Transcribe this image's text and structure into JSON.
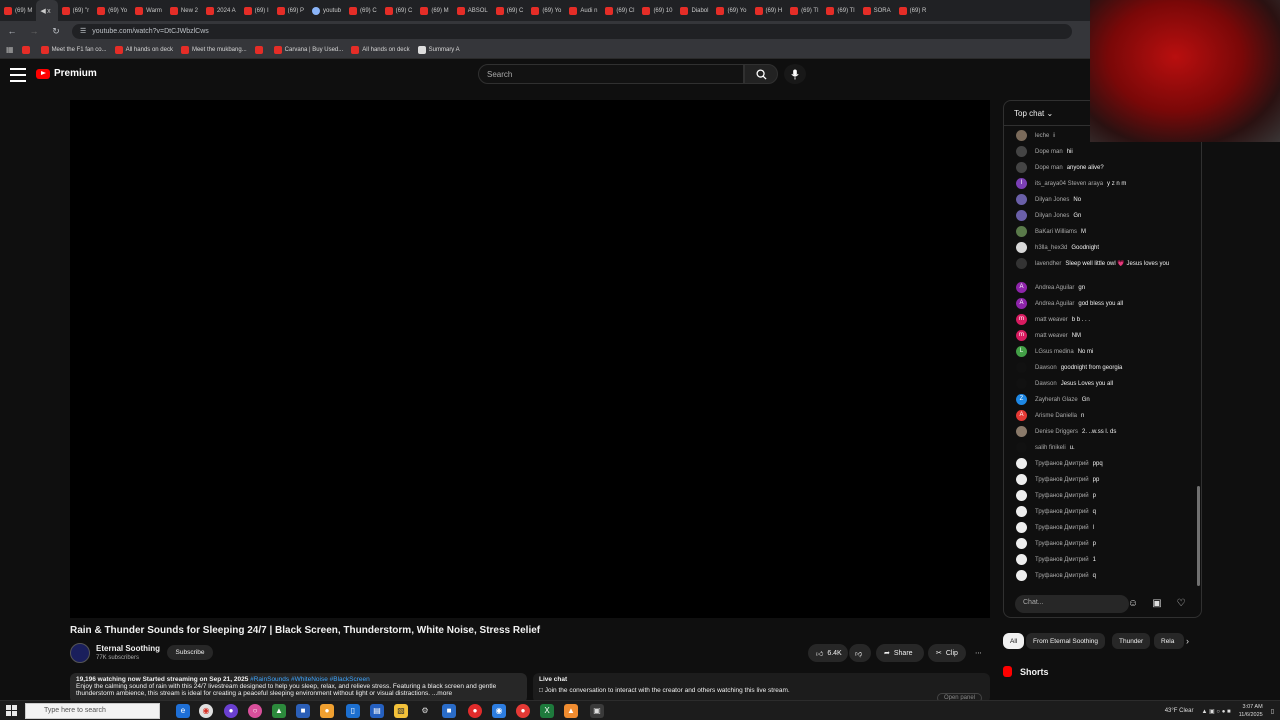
{
  "browser": {
    "tabs": [
      {
        "label": "(69) M",
        "icon": "youtube",
        "active": false
      },
      {
        "label": "",
        "icon": "volume",
        "active": true
      },
      {
        "label": "(69) \"r",
        "icon": "youtube",
        "active": false
      },
      {
        "label": "(69) Yo",
        "icon": "youtube",
        "active": false
      },
      {
        "label": "Warm",
        "icon": "youtube",
        "active": false
      },
      {
        "label": "New 2",
        "icon": "youtube",
        "active": false
      },
      {
        "label": "2024 A",
        "icon": "youtube",
        "active": false
      },
      {
        "label": "(69) I",
        "icon": "youtube",
        "active": false
      },
      {
        "label": "(69) P",
        "icon": "youtube",
        "active": false
      },
      {
        "label": "youtub",
        "icon": "globe",
        "active": false
      },
      {
        "label": "(69) C",
        "icon": "youtube",
        "active": false
      },
      {
        "label": "(69) C",
        "icon": "youtube",
        "active": false
      },
      {
        "label": "(69) M",
        "icon": "youtube",
        "active": false
      },
      {
        "label": "ABSOL",
        "icon": "youtube",
        "active": false
      },
      {
        "label": "(69) C",
        "icon": "youtube",
        "active": false
      },
      {
        "label": "(69) Yo",
        "icon": "youtube",
        "active": false
      },
      {
        "label": "Audi n",
        "icon": "youtube",
        "active": false
      },
      {
        "label": "(69) Cl",
        "icon": "youtube",
        "active": false
      },
      {
        "label": "(69) 10",
        "icon": "youtube",
        "active": false
      },
      {
        "label": "Diabol",
        "icon": "youtube",
        "active": false
      },
      {
        "label": "(69) Yo",
        "icon": "youtube",
        "active": false
      },
      {
        "label": "(69) H",
        "icon": "youtube",
        "active": false
      },
      {
        "label": "(69) Tl",
        "icon": "youtube",
        "active": false
      },
      {
        "label": "(69) Tl",
        "icon": "youtube",
        "active": false
      },
      {
        "label": "SORA",
        "icon": "youtube",
        "active": false
      },
      {
        "label": "(69) R",
        "icon": "youtube",
        "active": false
      }
    ],
    "url": "youtube.com/watch?v=DtCJWbzlCws",
    "bookmarks": [
      {
        "label": "",
        "icon": "youtube"
      },
      {
        "label": "Meet the F1 fan co...",
        "icon": "youtube"
      },
      {
        "label": "All hands on deck",
        "icon": "youtube"
      },
      {
        "label": "Meet the mukbang...",
        "icon": "youtube"
      },
      {
        "label": "",
        "icon": "youtube"
      },
      {
        "label": "Carvana | Buy Used...",
        "icon": "youtube"
      },
      {
        "label": "All hands on deck",
        "icon": "youtube"
      },
      {
        "label": "Summary A",
        "icon": "summary"
      }
    ]
  },
  "youtube": {
    "logo_text": "Premium",
    "search_placeholder": "Search"
  },
  "video": {
    "title": "Rain & Thunder Sounds for Sleeping 24/7 | Black Screen, Thunderstorm, White Noise, Stress Relief",
    "channel": "Eternal Soothing",
    "subscribers": "77K subscribers",
    "subscribe_label": "Subscribe",
    "likes": "6.4K",
    "share_label": "Share",
    "clip_label": "Clip",
    "description_stats": "19,196 watching now  Started streaming on Sep 21, 2025",
    "description_tags": "#RainSounds #WhiteNoise #BlackScreen",
    "description_text": "Enjoy the calming sound of rain with this 24/7 livestream designed to help you sleep, relax, and relieve stress. Featuring a black screen and gentle thunderstorm ambience, this stream is ideal for creating a peaceful sleeping environment without light or visual distractions. ...more",
    "live_chat_title": "Live chat",
    "live_chat_text": "Join the conversation to interact with the creator and others watching this live stream.",
    "open_panel_label": "Open panel"
  },
  "chat": {
    "mode_label": "Top chat",
    "input_placeholder": "Chat...",
    "messages": [
      {
        "author": "leche",
        "text": "i",
        "avatar_letter": "",
        "avatar_color": "#7a6a5a"
      },
      {
        "author": "Dope man",
        "text": "hii",
        "avatar_letter": "",
        "avatar_color": "#444444"
      },
      {
        "author": "Dope man",
        "text": "anyone alive?",
        "avatar_letter": "",
        "avatar_color": "#444444"
      },
      {
        "author": "its_araya04 Steven araya",
        "text": "y z n m",
        "avatar_letter": "I",
        "avatar_color": "#7b3fb5"
      },
      {
        "author": "Dilyan Jones",
        "text": "No",
        "avatar_letter": "",
        "avatar_color": "#6a5fa8"
      },
      {
        "author": "Dilyan Jones",
        "text": "Gn",
        "avatar_letter": "",
        "avatar_color": "#6a5fa8"
      },
      {
        "author": "BaKari Williams",
        "text": "M",
        "avatar_letter": "",
        "avatar_color": "#5a7a4a"
      },
      {
        "author": "h3lla_hex3d",
        "text": "Goodnight",
        "avatar_letter": "",
        "avatar_color": "#d8d8d8"
      },
      {
        "author": "lavendher",
        "text": "Sleep well little owl 💗 Jesus loves you",
        "avatar_letter": "",
        "avatar_color": "#333333"
      },
      {
        "author": "Andrea Aguilar",
        "text": "gn",
        "avatar_letter": "A",
        "avatar_color": "#8e24aa"
      },
      {
        "author": "Andrea Aguilar",
        "text": "god bless you all",
        "avatar_letter": "A",
        "avatar_color": "#8e24aa"
      },
      {
        "author": "matt weaver",
        "text": "b b . . .",
        "avatar_letter": "m",
        "avatar_color": "#d81b60"
      },
      {
        "author": "matt weaver",
        "text": "NM",
        "avatar_letter": "m",
        "avatar_color": "#d81b60"
      },
      {
        "author": "LGsus medina",
        "text": "No mi",
        "avatar_letter": "L",
        "avatar_color": "#43a047"
      },
      {
        "author": "Dawson",
        "text": "goodnight from georgia",
        "avatar_letter": "",
        "avatar_color": "#111111"
      },
      {
        "author": "Dawson",
        "text": "Jesus Loves you all",
        "avatar_letter": "",
        "avatar_color": "#111111"
      },
      {
        "author": "Zayherah Glaze",
        "text": "Gn",
        "avatar_letter": "Z",
        "avatar_color": "#1e88e5"
      },
      {
        "author": "Arisme Daniella",
        "text": "n",
        "avatar_letter": "A",
        "avatar_color": "#e53935"
      },
      {
        "author": "Denise Driggers",
        "text": "2. ..w.ss l. ds",
        "avatar_letter": "",
        "avatar_color": "#8a7a6a"
      },
      {
        "author": "salih finikeli",
        "text": "u.",
        "avatar_letter": "",
        "avatar_color": "#111111"
      },
      {
        "author": "Труфанов Дмитрий",
        "text": "ppq",
        "avatar_letter": "",
        "avatar_color": "#eeeeee"
      },
      {
        "author": "Труфанов Дмитрий",
        "text": "pp",
        "avatar_letter": "",
        "avatar_color": "#eeeeee"
      },
      {
        "author": "Труфанов Дмитрий",
        "text": "p",
        "avatar_letter": "",
        "avatar_color": "#eeeeee"
      },
      {
        "author": "Труфанов Дмитрий",
        "text": "q",
        "avatar_letter": "",
        "avatar_color": "#eeeeee"
      },
      {
        "author": "Труфанов Дмитрий",
        "text": "l",
        "avatar_letter": "",
        "avatar_color": "#eeeeee"
      },
      {
        "author": "Труфанов Дмитрий",
        "text": "p",
        "avatar_letter": "",
        "avatar_color": "#eeeeee"
      },
      {
        "author": "Труфанов Дмитрий",
        "text": "1",
        "avatar_letter": "",
        "avatar_color": "#eeeeee"
      },
      {
        "author": "Труфанов Дмитрий",
        "text": "q",
        "avatar_letter": "",
        "avatar_color": "#eeeeee"
      }
    ]
  },
  "filter_chips": [
    "All",
    "From Eternal Soothing",
    "Thunder",
    "Rela"
  ],
  "shorts_title": "Shorts",
  "taskbar": {
    "search_placeholder": "Type here to search",
    "weather": "43°F  Clear",
    "time": "3:07 AM",
    "date": "11/6/2025"
  },
  "colors": {
    "accent": "#ff0000",
    "link": "#3ea6ff",
    "background": "#0f0f0f"
  }
}
